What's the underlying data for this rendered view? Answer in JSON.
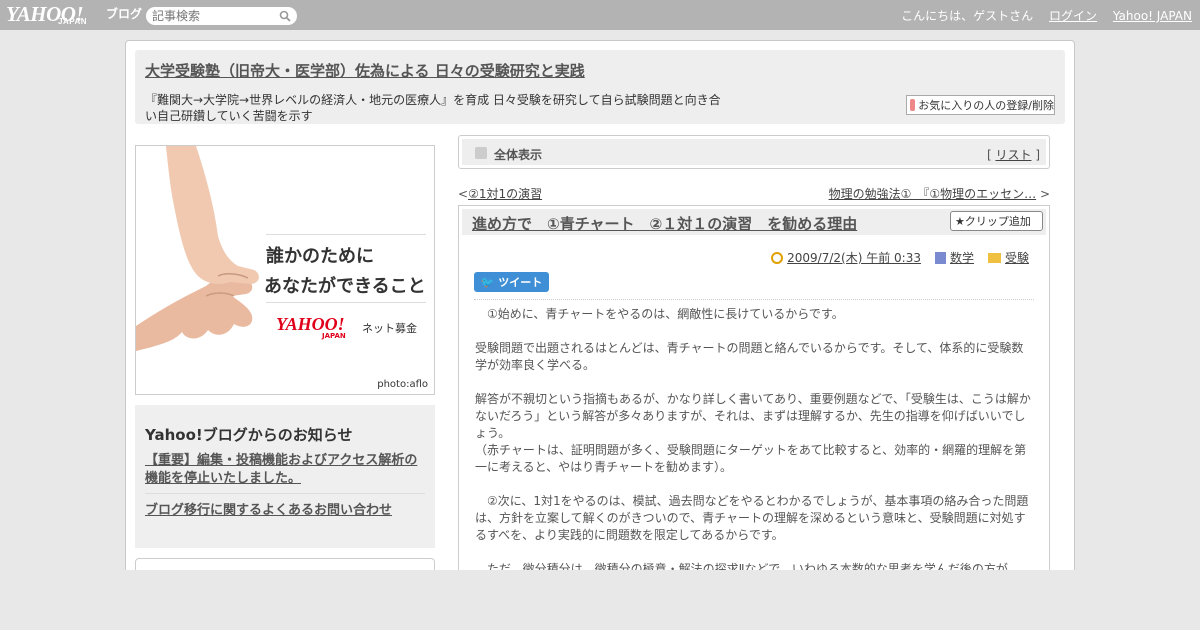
{
  "topbar": {
    "logo_main": "YAHOO!",
    "logo_sub": "JAPAN",
    "logo_blog": "ブログ",
    "search_placeholder": "記事検索",
    "greeting": "こんにちは、ゲストさん",
    "login": "ログイン",
    "yahoo_japan": "Yahoo! JAPAN"
  },
  "header": {
    "title": "大学受験塾（旧帝大・医学部）佐為による 日々の受験研究と実践",
    "description": "『難関大→大学院→世界レベルの経済人・地元の医療人』を育成 日々受験を研究して自ら試験問題と向き合い自己研鑽していく苦闘を示す",
    "favorite_button": "お気に入りの人の登録/削除"
  },
  "banner": {
    "line1": "誰かのために",
    "line2": "あなたができること",
    "logo": "YAHOO!",
    "logo_sub": "JAPAN",
    "tagline": "ネット募金",
    "credit": "photo:aflo"
  },
  "notice": {
    "title": "Yahoo!ブログからのお知らせ",
    "items": [
      "【重要】編集・投稿機能およびアクセス解析の機能を停止いたしました。",
      "ブログ移行に関するよくあるお問い合わせ"
    ]
  },
  "allbar": {
    "label": "全体表示",
    "list_prefix": "[",
    "list_link": "リスト",
    "list_suffix": "]"
  },
  "nav": {
    "prev_arrow": "<",
    "prev": "②1対1の演習",
    "next": "物理の勉強法①　『①物理のエッセン…",
    "next_arrow": ">"
  },
  "article": {
    "title": "進め方で　①青チャート　②１対１の演習　を勧める理由",
    "clip_button": "クリップ追加",
    "date": "2009/7/2(木) 午前 0:33",
    "category1": "数学",
    "category2": "受験",
    "tweet_button": "ツイート",
    "paragraphs": [
      "　①始めに、青チャートをやるのは、網敵性に長けているからです。",
      "",
      "受験問題で出題されるはとんどは、青チャートの問題と絡んでいるからです。そして、体系的に受験数学が効率良く学べる。",
      "",
      "解答が不親切という指摘もあるが、かなり詳しく書いてあり、重要例題などで、「受験生は、こうは解かないだろう」という解答が多々ありますが、それは、まずは理解するか、先生の指導を仰げばいいでしょう。",
      "（赤チャートは、証明問題が多く、受験問題にターゲットをあて比較すると、効率的・網羅的理解を第一に考えると、やはり青チャートを勧めます）。",
      "",
      "　②次に、1対1をやるのは、模試、過去問などをやるとわかるでしょうが、基本事項の絡み合った問題は、方針を立案して解くのがきついので、青チャートの理解を深めるという意味と、受験問題に対処するすべを、より実践的に問題数を限定してあるからです。",
      "",
      "　ただ、微分積分は、微積分の極意・解法の探求Ⅱなどで、いわゆる本数的な思考を学んだ後の方が"
    ]
  }
}
